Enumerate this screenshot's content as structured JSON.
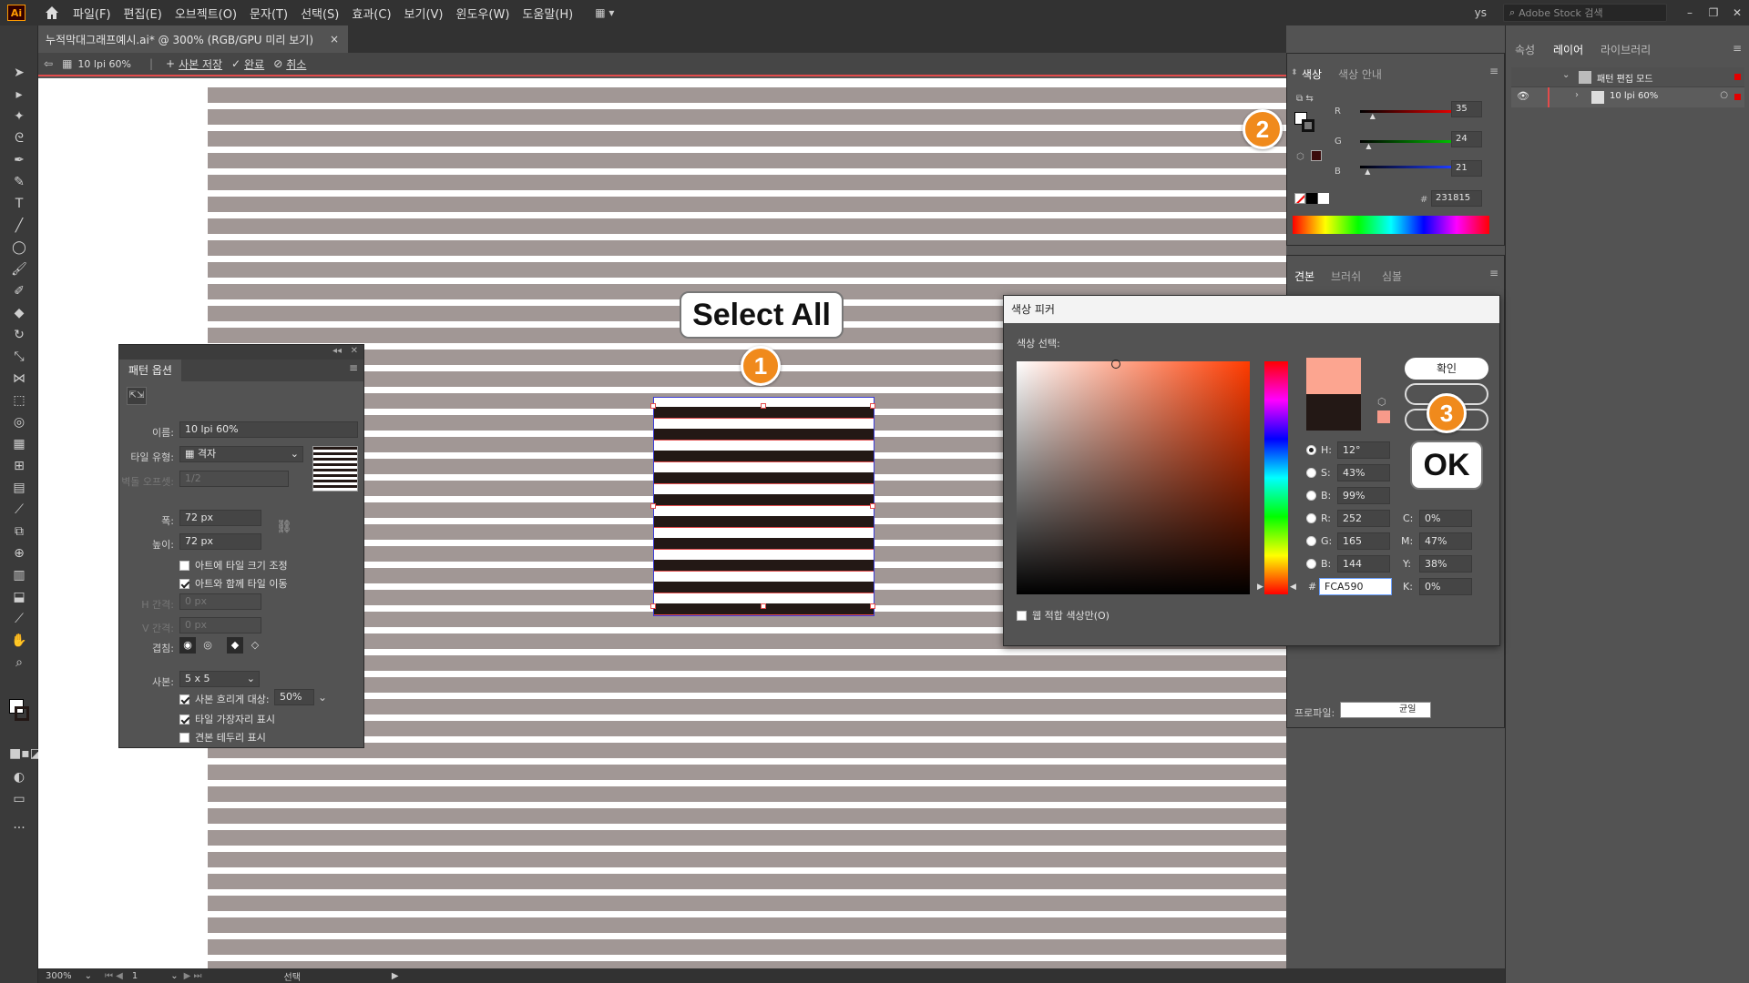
{
  "app": {
    "logo_text": "Ai",
    "menu": [
      "파일(F)",
      "편집(E)",
      "오브젝트(O)",
      "문자(T)",
      "선택(S)",
      "효과(C)",
      "보기(V)",
      "윈도우(W)",
      "도움말(H)"
    ],
    "user_initials": "ys",
    "stock_search_placeholder": "Adobe Stock 검색"
  },
  "document": {
    "tab_title": "누적막대그래프예시.ai* @ 300% (RGB/GPU 미리 보기)",
    "close_label": "×"
  },
  "isolation_bar": {
    "pattern_name": "10 lpi 60%",
    "save_copy_label": "사본 저장",
    "done_label": "완료",
    "cancel_label": "취소"
  },
  "pattern_options": {
    "title": "패턴 옵션",
    "name_label": "이름:",
    "name_value": "10 lpi 60%",
    "tile_type_label": "타일 유형:",
    "tile_type_value": "격자",
    "brick_offset_label": "벽돌 오프셋:",
    "brick_offset_value": "1/2",
    "width_label": "폭:",
    "width_value": "72 px",
    "height_label": "높이:",
    "height_value": "72 px",
    "size_tile_to_art_label": "아트에 타일 크기 조정",
    "size_tile_to_art_checked": false,
    "move_tile_with_art_label": "아트와 함께 타일 이동",
    "move_tile_with_art_checked": true,
    "h_spacing_label": "H 간격:",
    "h_spacing_value": "0 px",
    "v_spacing_label": "V 간격:",
    "v_spacing_value": "0 px",
    "overlap_label": "겹침:",
    "copies_label": "사본:",
    "copies_value": "5 x 5",
    "dim_copies_label": "사본 흐리게 대상:",
    "dim_copies_checked": true,
    "dim_copies_value": "50%",
    "show_tile_edge_label": "타일 가장자리 표시",
    "show_tile_edge_checked": true,
    "show_swatch_bounds_label": "견본 테두리 표시",
    "show_swatch_bounds_checked": false
  },
  "color_panel": {
    "tabs": [
      "색상",
      "색상 안내"
    ],
    "r_label": "R",
    "r_value": "35",
    "r_fraction": 0.137,
    "g_label": "G",
    "g_value": "24",
    "g_fraction": 0.094,
    "b_label": "B",
    "b_value": "21",
    "b_fraction": 0.082,
    "hash_label": "#",
    "hex_value": "231815"
  },
  "swatch_panel": {
    "tabs": [
      "견본",
      "브러쉬",
      "심볼"
    ],
    "profile_label": "프로파일:",
    "profile_value": "균일"
  },
  "right_dock": {
    "tabs": [
      "속성",
      "레이어",
      "라이브러리"
    ],
    "layers": [
      {
        "name": "패턴 편집 모드"
      },
      {
        "name": "10 lpi 60%"
      }
    ]
  },
  "color_picker": {
    "title": "색상 피커",
    "select_color_label": "색상 선택:",
    "ok_label": "확인",
    "h_label": "H:",
    "h_value": "12°",
    "s_label": "S:",
    "s_value": "43%",
    "b_label": "B:",
    "b_value": "99%",
    "r_label": "R:",
    "r_value": "252",
    "g_label": "G:",
    "g_value": "165",
    "bb_label": "B:",
    "bb_value": "144",
    "hex_label": "#",
    "hex_value": "FCA590",
    "c_label": "C:",
    "c_value": "0%",
    "m_label": "M:",
    "m_value": "47%",
    "y_label": "Y:",
    "y_value": "38%",
    "k_label": "K:",
    "k_value": "0%",
    "web_only_label": "웹 적합 색상만(O)",
    "new_color": "#FCA590",
    "old_color": "#231815"
  },
  "annotations": {
    "select_all_label": "Select All",
    "ok_label": "OK",
    "step1": "1",
    "step2": "2",
    "step3": "3"
  },
  "statusbar": {
    "zoom": "300%",
    "page": "1",
    "tool": "선택"
  },
  "colors": {
    "stripe_gray": "#a19795",
    "stripe_dark": "#231815",
    "accent_orange": "#f08a1c",
    "tile_edge": "#e34b4b"
  }
}
